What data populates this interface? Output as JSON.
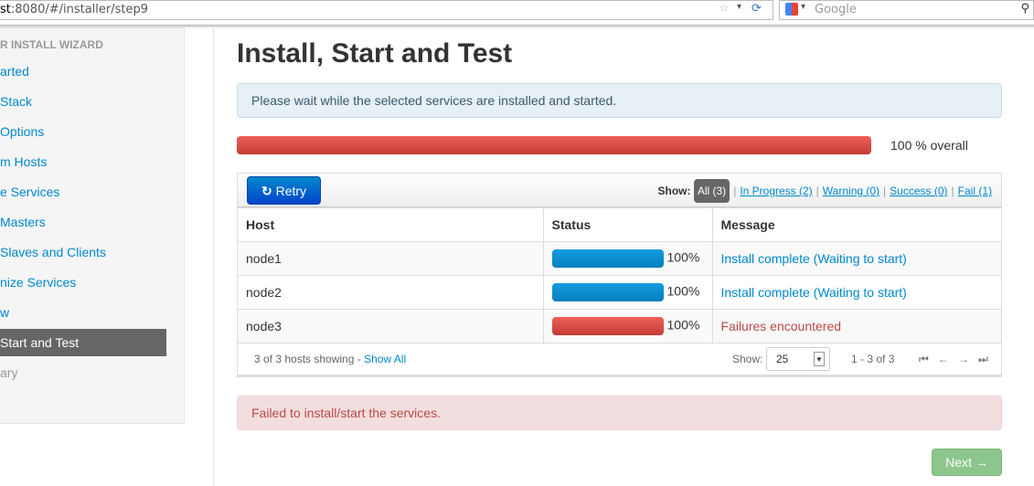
{
  "browser": {
    "url_host_part": "st",
    "url_rest": ":8080/#/installer/step9",
    "search_placeholder": "Google"
  },
  "sidebar": {
    "header": "R INSTALL WIZARD",
    "items": [
      {
        "label": "arted",
        "state": "link"
      },
      {
        "label": " Stack",
        "state": "link"
      },
      {
        "label": "Options",
        "state": "link"
      },
      {
        "label": "m Hosts",
        "state": "link"
      },
      {
        "label": "e Services",
        "state": "link"
      },
      {
        "label": " Masters",
        "state": "link"
      },
      {
        "label": " Slaves and Clients",
        "state": "link"
      },
      {
        "label": "nize Services",
        "state": "link"
      },
      {
        "label": "w",
        "state": "link"
      },
      {
        "label": " Start and Test",
        "state": "active"
      },
      {
        "label": "ary",
        "state": "disabled"
      }
    ]
  },
  "main": {
    "title": "Install, Start and Test",
    "info": "Please wait while the selected services are installed and started.",
    "overall": {
      "percent": 100,
      "label": "100 % overall"
    },
    "retry_label": "Retry",
    "filters": {
      "label": "Show:",
      "items": [
        "All (3)",
        "In Progress (2)",
        "Warning (0)",
        "Success (0)",
        "Fail (1)"
      ],
      "selected": "All (3)"
    },
    "columns": [
      "Host",
      "Status",
      "Message"
    ],
    "rows": [
      {
        "host": "node1",
        "percent": 100,
        "pct_label": "100%",
        "message": "Install complete (Waiting to start)",
        "status": "ok"
      },
      {
        "host": "node2",
        "percent": 100,
        "pct_label": "100%",
        "message": "Install complete (Waiting to start)",
        "status": "ok"
      },
      {
        "host": "node3",
        "percent": 100,
        "pct_label": "100%",
        "message": "Failures encountered",
        "status": "fail"
      }
    ],
    "footer": {
      "showing": "3 of 3 hosts showing - ",
      "show_all": "Show All",
      "show_label": "Show:",
      "page_size": "25",
      "range": "1 - 3 of 3"
    },
    "error": "Failed to install/start the services.",
    "next_label": "Next →"
  },
  "colors": {
    "link": "#0088cc",
    "danger": "#b94a48",
    "progress_red": "#c43c35",
    "progress_blue": "#0480be",
    "next": "#8dc68d"
  }
}
